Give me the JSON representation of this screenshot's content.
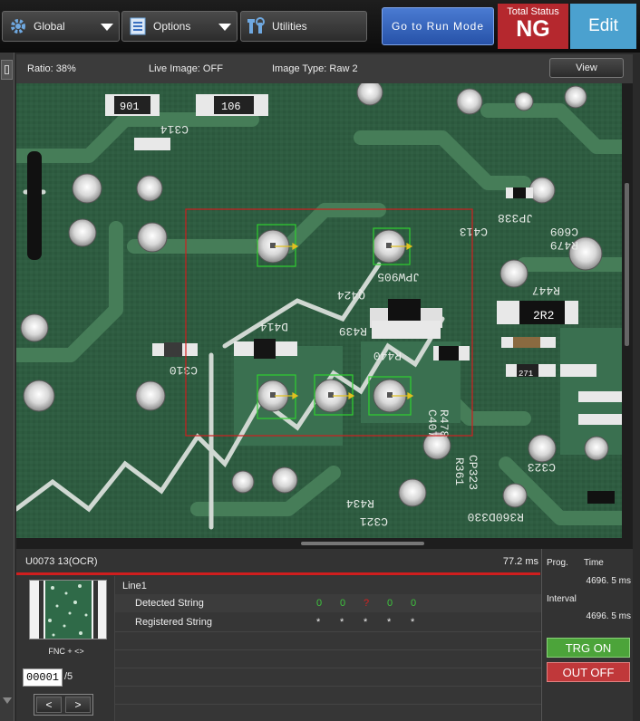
{
  "toolbar": {
    "global_label": "Global",
    "options_label": "Options",
    "utilities_label": "Utilities",
    "run_mode_label": "Go to Run Mode",
    "total_status_label": "Total Status",
    "total_status_value": "NG",
    "edit_label": "Edit"
  },
  "image_info": {
    "ratio": "Ratio: 38%",
    "live_image": "Live Image: OFF",
    "image_type": "Image Type: Raw 2",
    "view_label": "View"
  },
  "pcb_labels": [
    "901",
    "106",
    "C314",
    "JP338",
    "C413",
    "C609",
    "R479",
    "R447",
    "2R2",
    "JPW905",
    "Q424",
    "R439",
    "D414",
    "R440",
    "C310",
    "C407",
    "R478",
    "CP323",
    "R361",
    "C323",
    "R434",
    "C321",
    "R360D330",
    "271"
  ],
  "tool": {
    "name": "U0073 13(OCR)",
    "time": "77.2 ms",
    "group": "Line1",
    "detected_label": "Detected String",
    "registered_label": "Registered String",
    "detected": [
      {
        "char": "0",
        "color": "#3ec43e"
      },
      {
        "char": "0",
        "color": "#3ec43e"
      },
      {
        "char": "?",
        "color": "#d82020"
      },
      {
        "char": "0",
        "color": "#3ec43e"
      },
      {
        "char": "0",
        "color": "#3ec43e"
      }
    ],
    "registered": [
      "*",
      "*",
      "*",
      "*",
      "*"
    ],
    "fnc_label": "FNC + <>",
    "index_value": "00001",
    "index_total": "/5",
    "prev_label": "<",
    "next_label": ">"
  },
  "side": {
    "prog_label": "Prog.",
    "time_label": "Time",
    "time_value": "4696. 5 ms",
    "interval_label": "Interval",
    "interval_value": "4696. 5 ms",
    "trg_label": "TRG ON",
    "out_label": "OUT OFF"
  },
  "colors": {
    "status_ng": "#b5282e",
    "edit": "#4ba1cf",
    "run_mode": "#2f5eb8",
    "trg_on": "#4ca43a",
    "out_off": "#c0383a",
    "roi_box": "#d01e1e",
    "detect_box": "#2fd02f"
  }
}
